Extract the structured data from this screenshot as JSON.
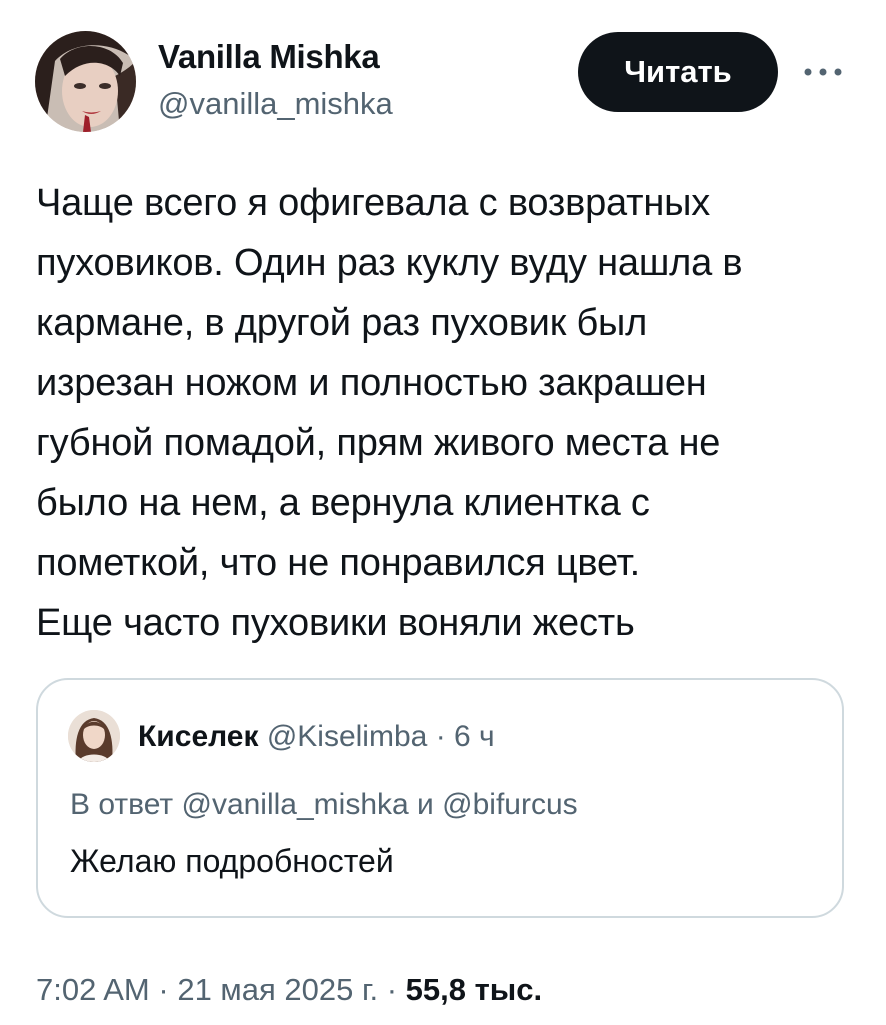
{
  "author": {
    "display_name": "Vanilla Mishka",
    "handle": "@vanilla_mishka"
  },
  "follow_button": {
    "label": "Читать"
  },
  "tweet": {
    "text": "Чаще всего я офигевала с возвратных\nпуховиков. Один раз куклу вуду нашла в\nкармане, в другой раз пуховик был\nизрезан ножом и полностью закрашен\nгубной помадой, прям живого места не\nбыло на нем, а вернула клиентка с\nпометкой, что не понравился цвет.\nЕще часто пуховики воняли жесть"
  },
  "quote": {
    "name": "Киселек",
    "handle": "@Kiselimba",
    "separator": "·",
    "time": "6 ч",
    "reply_prefix": "В ответ",
    "reply_user_1": "@vanilla_mishka",
    "reply_and": "и",
    "reply_user_2": "@bifurcus",
    "text": "Желаю подробностей"
  },
  "meta": {
    "time": "7:02 AM",
    "separator": "·",
    "date": "21 мая 2025 г.",
    "views": "55,8 тыс."
  },
  "colors": {
    "text_primary": "#0f1419",
    "text_secondary": "#536471",
    "border": "#cfd9de",
    "button_bg": "#0f1419"
  },
  "icons": {
    "more": "more-horizontal-icon"
  }
}
